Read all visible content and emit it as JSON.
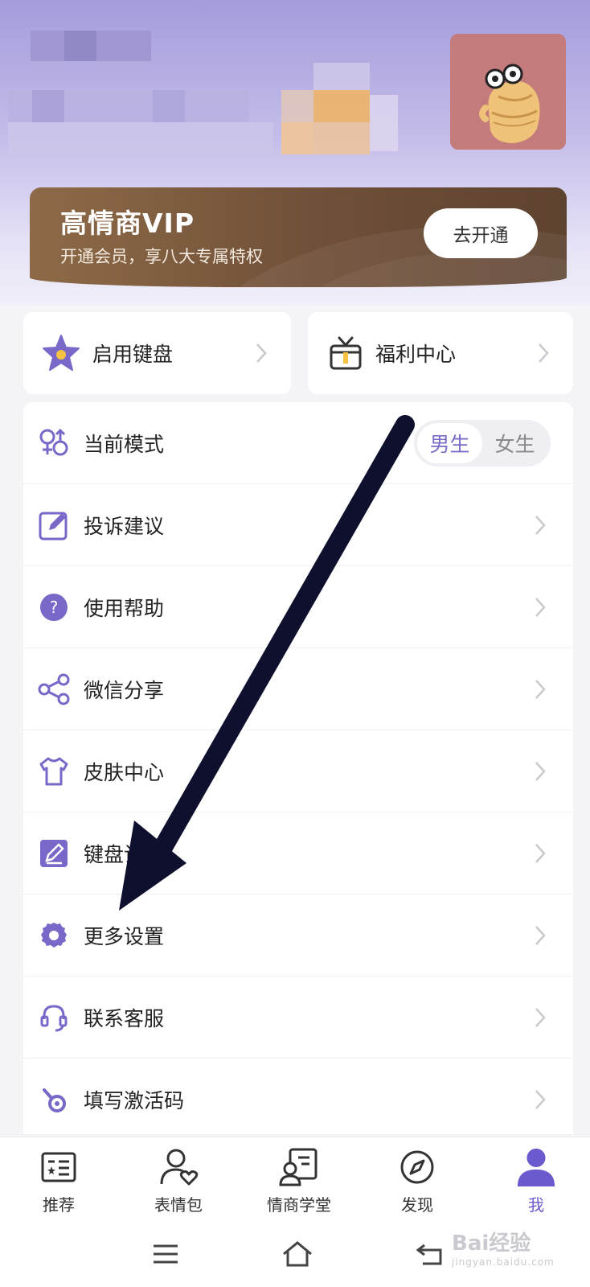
{
  "vip": {
    "title": "高情商VIP",
    "subtitle": "开通会员，享八大专属特权",
    "button": "去开通"
  },
  "quick": [
    {
      "label": "启用键盘",
      "icon": "star-keyboard-icon"
    },
    {
      "label": "福利中心",
      "icon": "gift-icon"
    }
  ],
  "menu": {
    "mode": {
      "label": "当前模式",
      "options": [
        "男生",
        "女生"
      ],
      "selected": "男生"
    },
    "items": [
      {
        "label": "投诉建议",
        "icon": "edit-note-icon"
      },
      {
        "label": "使用帮助",
        "icon": "help-icon"
      },
      {
        "label": "微信分享",
        "icon": "share-icon"
      },
      {
        "label": "皮肤中心",
        "icon": "shirt-icon"
      },
      {
        "label": "键盘设置",
        "icon": "pencil-icon"
      },
      {
        "label": "更多设置",
        "icon": "gear-icon"
      },
      {
        "label": "联系客服",
        "icon": "headset-icon"
      },
      {
        "label": "填写激活码",
        "icon": "key-icon"
      }
    ]
  },
  "tabs": [
    {
      "label": "推荐",
      "icon": "recommend-icon"
    },
    {
      "label": "表情包",
      "icon": "sticker-user-icon"
    },
    {
      "label": "情商学堂",
      "icon": "classroom-icon"
    },
    {
      "label": "发现",
      "icon": "compass-icon"
    },
    {
      "label": "我",
      "icon": "profile-icon",
      "active": true
    }
  ],
  "watermark": {
    "brand": "Bai经验",
    "url": "jingyan.baidu.com"
  },
  "colors": {
    "accent": "#6a5acd",
    "vip_bg": "#7a5a40",
    "annotation_arrow": "#0f0f2e"
  }
}
